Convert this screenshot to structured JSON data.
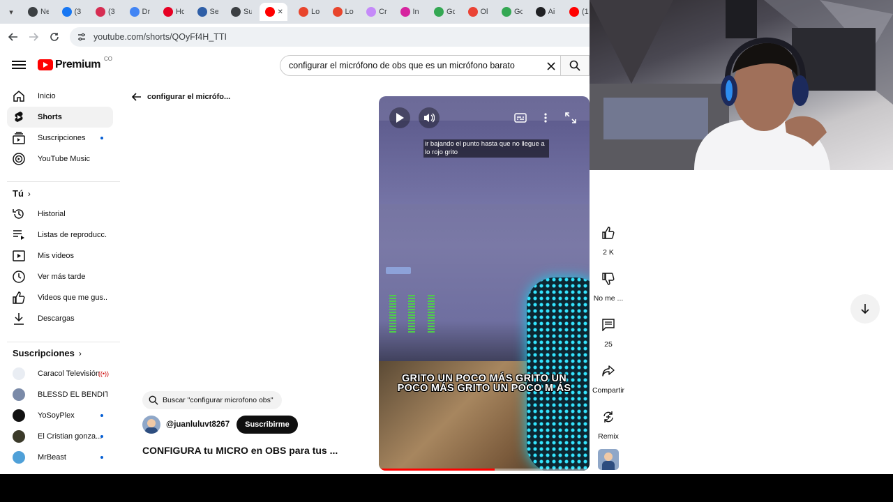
{
  "browser": {
    "tabs": [
      {
        "label": "Ne",
        "color": "#3c4043"
      },
      {
        "label": "(3",
        "color": "#1877f2"
      },
      {
        "label": "(3",
        "color": "#d62d52"
      },
      {
        "label": "Dr",
        "color": "#4285f4"
      },
      {
        "label": "Ho",
        "color": "#e60023"
      },
      {
        "label": "Se",
        "color": "#2f5fa7"
      },
      {
        "label": "Su",
        "color": "#3c4043"
      },
      {
        "label": "",
        "color": "#ff0000"
      },
      {
        "label": "Lo",
        "color": "#e8452c"
      },
      {
        "label": "Lo",
        "color": "#e8452c"
      },
      {
        "label": "Cr",
        "color": "#c58af9"
      },
      {
        "label": "In",
        "color": "#d6249f"
      },
      {
        "label": "Go",
        "color": "#34a853"
      },
      {
        "label": "Ol",
        "color": "#ea4335"
      },
      {
        "label": "Go",
        "color": "#34a853"
      },
      {
        "label": "Ai",
        "color": "#202124"
      },
      {
        "label": "(1",
        "color": "#ff0000"
      }
    ],
    "active_tab_close": "✕",
    "url": "youtube.com/shorts/QOyFf4H_TTI"
  },
  "header": {
    "logo_text": "Premium",
    "logo_country": "CO",
    "search_query": "configurar el micrófono de obs que es un micrófono barato"
  },
  "sidebar": {
    "main": [
      {
        "label": "Inicio",
        "icon": "home-icon"
      },
      {
        "label": "Shorts",
        "icon": "shorts-icon",
        "active": true
      },
      {
        "label": "Suscripciones",
        "icon": "subscriptions-icon",
        "dot": true
      },
      {
        "label": "YouTube Music",
        "icon": "youtube-music-icon"
      }
    ],
    "you_header": "Tú",
    "you": [
      {
        "label": "Historial",
        "icon": "history-icon"
      },
      {
        "label": "Listas de reproducc...",
        "icon": "playlists-icon"
      },
      {
        "label": "Mis videos",
        "icon": "my-videos-icon"
      },
      {
        "label": "Ver más tarde",
        "icon": "watch-later-icon"
      },
      {
        "label": "Videos que me gus...",
        "icon": "liked-videos-icon"
      },
      {
        "label": "Descargas",
        "icon": "downloads-icon"
      }
    ],
    "subs_header": "Suscripciones",
    "subscriptions": [
      {
        "label": "Caracol Televisión",
        "color": "#e9edf3",
        "live": true
      },
      {
        "label": "BLESSD EL BENDIT...",
        "color": "#7a8aa8",
        "dot": false
      },
      {
        "label": "YoSoyPlex",
        "color": "#111111",
        "dot": true
      },
      {
        "label": "El Cristian gonza...",
        "color": "#3b3a2a",
        "dot": true
      },
      {
        "label": "MrBeast",
        "color": "#4fa0d8",
        "dot": true
      }
    ]
  },
  "shorts": {
    "back_title": "configurar el micrófo...",
    "caption": "ir bajando el punto hasta que no llegue a lo rojo grito",
    "burned_caption": "GRITO UN POCO MÁS GRITO UN POCO MÁS GRITO UN POCO M ÁS",
    "progress": 0.55,
    "search_chip": "Buscar \"configurar microfono obs\"",
    "channel": "@juanluluvt8267",
    "subscribe": "Suscribirme",
    "title": "CONFIGURA tu MICRO en OBS para tus ..."
  },
  "actions": {
    "likes": "2 K",
    "dislike": "No me ...",
    "comments": "25",
    "share": "Compartir",
    "remix": "Remix"
  }
}
